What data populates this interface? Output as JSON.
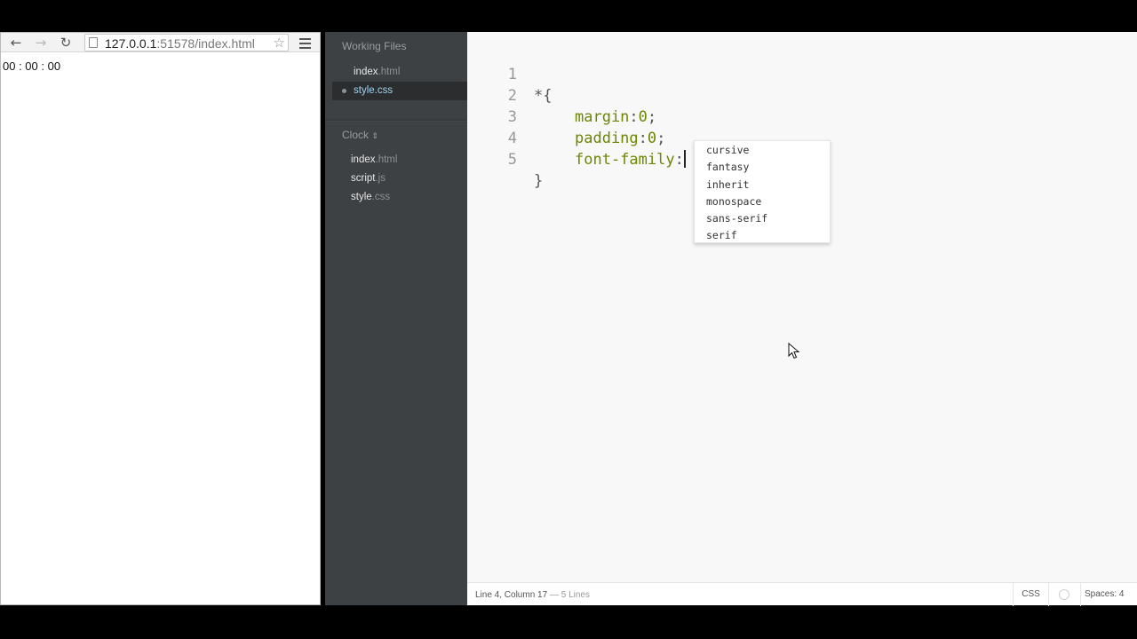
{
  "browser": {
    "url_host": "127.0.0.1",
    "url_rest": ":51578/index.html",
    "page_text": "00 : 00 : 00"
  },
  "sidebar": {
    "working_files_title": "Working Files",
    "working_files": [
      {
        "base": "index",
        "ext": ".html",
        "selected": false
      },
      {
        "base": "style",
        "ext": ".css",
        "selected": true
      }
    ],
    "project_title": "Clock",
    "project_chevron": "⌃⌄",
    "project_files": [
      {
        "base": "index",
        "ext": ".html"
      },
      {
        "base": "script",
        "ext": ".js"
      },
      {
        "base": "style",
        "ext": ".css"
      }
    ]
  },
  "editor": {
    "line_numbers": [
      "1",
      "2",
      "3",
      "4",
      "5"
    ],
    "lines": [
      {
        "a": "*{"
      },
      {
        "prop": "margin",
        "sep": ":",
        "val": "0",
        "end": ";"
      },
      {
        "prop": "padding",
        "sep": ":",
        "val": "0",
        "end": ";"
      },
      {
        "prop": "font-family",
        "sep": ":"
      },
      {
        "a": "}"
      }
    ],
    "hints": [
      "cursive",
      "fantasy",
      "inherit",
      "monospace",
      "sans-serif",
      "serif"
    ]
  },
  "status_bar": {
    "cursor_position": "Line 4, Column 17",
    "line_count": " — 5 Lines",
    "language": "CSS",
    "indent": "Spaces: 4"
  },
  "colors": {
    "sidebar_bg": "#3e4144",
    "selected_file": "#9fd4f2",
    "css_property": "#6d8600",
    "editor_bg": "#f8f8f8"
  }
}
